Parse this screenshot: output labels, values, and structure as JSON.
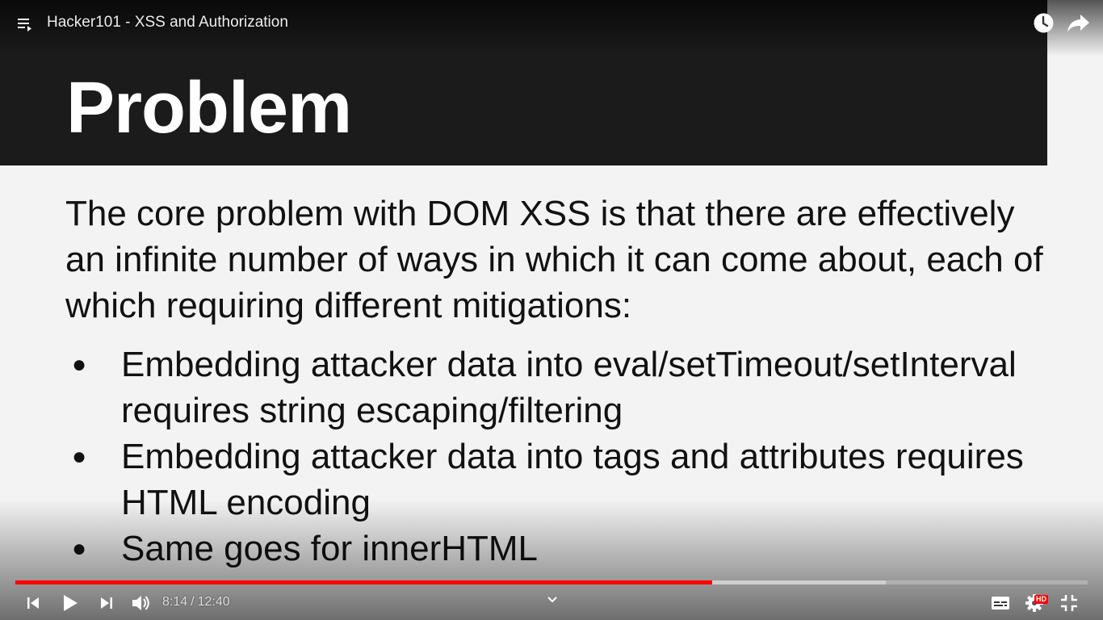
{
  "video": {
    "title": "Hacker101 - XSS and Authorization",
    "current_time": "8:14",
    "duration": "12:40",
    "time_separator": "/",
    "progress_fraction": 0.6495,
    "buffered_fraction": 0.812,
    "quality_badge": "HD"
  },
  "slide": {
    "title": "Problem",
    "intro": "The core problem with DOM XSS is that there are effectively an infinite number of ways in which it can come about, each of which requiring different mitigations:",
    "bullet_char": "●",
    "bullets": [
      "Embedding attacker data into eval/setTimeout/setInterval requires string escaping/filtering",
      "Embedding attacker data into tags and attributes requires HTML encoding",
      "Same goes for innerHTML"
    ]
  },
  "icons": {
    "playlist": "playlist-icon",
    "watch_later": "clock-icon",
    "share": "share-arrow-icon",
    "previous": "skip-previous-icon",
    "play": "play-icon",
    "next": "skip-next-icon",
    "volume": "volume-icon",
    "chevron": "chevron-down-icon",
    "subtitles": "subtitles-icon",
    "settings": "gear-icon",
    "exit_fullscreen": "exit-fullscreen-icon"
  },
  "colors": {
    "progress_played": "#ff0000",
    "slide_header_bg": "#1b1b1b",
    "slide_bg": "#f3f3f3"
  }
}
